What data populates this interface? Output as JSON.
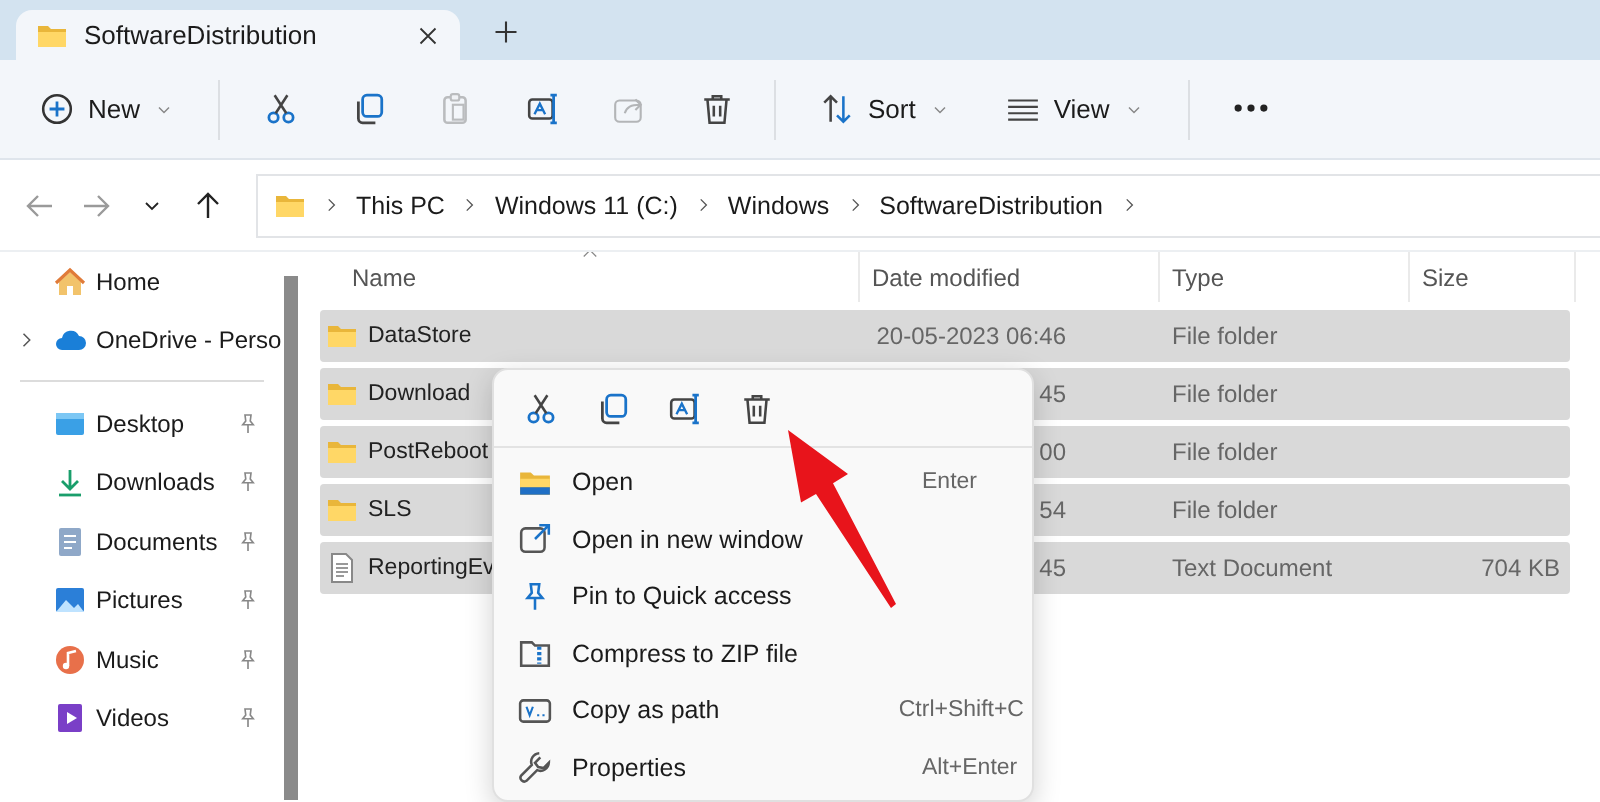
{
  "window": {
    "tabs": [
      {
        "title": "SoftwareDistribution",
        "selected": true
      }
    ]
  },
  "toolbar": {
    "items": [
      {
        "kind": "new",
        "label": "New",
        "disabled": false
      },
      {
        "kind": "separator"
      },
      {
        "kind": "cut",
        "disabled": false
      },
      {
        "kind": "copy",
        "disabled": false
      },
      {
        "kind": "paste",
        "disabled": true
      },
      {
        "kind": "rename",
        "disabled": false
      },
      {
        "kind": "share",
        "disabled": true
      },
      {
        "kind": "delete",
        "disabled": false
      },
      {
        "kind": "separator"
      },
      {
        "kind": "sort",
        "label": "Sort",
        "disabled": false
      },
      {
        "kind": "view",
        "label": "View",
        "disabled": false
      },
      {
        "kind": "separator"
      },
      {
        "kind": "more",
        "disabled": false
      }
    ]
  },
  "navigation": {
    "buttons": [
      {
        "kind": "back",
        "disabled": true
      },
      {
        "kind": "forward",
        "disabled": true
      },
      {
        "kind": "recent",
        "disabled": false
      },
      {
        "kind": "up",
        "disabled": false
      }
    ],
    "breadcrumbs": [
      "This PC",
      "Windows 11 (C:)",
      "Windows",
      "SoftwareDistribution"
    ]
  },
  "sidebar": {
    "top": [
      {
        "kind": "home",
        "label": "Home",
        "expandable": false
      },
      {
        "kind": "cloud",
        "label": "OneDrive - Perso",
        "expandable": true
      }
    ],
    "quick_access": [
      {
        "kind": "desktop",
        "label": "Desktop",
        "pinned": true
      },
      {
        "kind": "downloads",
        "label": "Downloads",
        "pinned": true
      },
      {
        "kind": "documents",
        "label": "Documents",
        "pinned": true
      },
      {
        "kind": "pictures",
        "label": "Pictures",
        "pinned": true
      },
      {
        "kind": "music",
        "label": "Music",
        "pinned": true
      },
      {
        "kind": "videos",
        "label": "Videos",
        "pinned": true
      }
    ]
  },
  "table": {
    "columns": [
      {
        "label": "Name",
        "sorted": true
      },
      {
        "label": "Date modified",
        "sorted": false
      },
      {
        "label": "Type",
        "sorted": false
      },
      {
        "label": "Size",
        "sorted": false
      }
    ],
    "rows": [
      {
        "kind": "folder",
        "name": "DataStore",
        "date": "20-05-2023 06:46",
        "type": "File folder",
        "selected": true
      },
      {
        "kind": "folder",
        "name": "Download",
        "date": "45",
        "type": "File folder",
        "selected": true
      },
      {
        "kind": "folder",
        "name": "PostReboot",
        "date": "00",
        "type": "File folder",
        "selected": true
      },
      {
        "kind": "folder",
        "name": "SLS",
        "date": "54",
        "type": "File folder",
        "selected": true
      },
      {
        "kind": "document",
        "name": "ReportingEv",
        "date": "45",
        "type": "Text Document",
        "size": "704 KB",
        "selected": true
      }
    ]
  },
  "context_menu": {
    "quick_actions": [
      {
        "kind": "cut"
      },
      {
        "kind": "copy"
      },
      {
        "kind": "rename"
      },
      {
        "kind": "delete"
      }
    ],
    "items": [
      {
        "kind": "open",
        "label": "Open",
        "shortcut": "Enter"
      },
      {
        "kind": "new_window",
        "label": "Open in new window"
      },
      {
        "kind": "pin",
        "label": "Pin to Quick access"
      },
      {
        "kind": "zip",
        "label": "Compress to ZIP file"
      },
      {
        "kind": "path",
        "label": "Copy as path",
        "shortcut": "Ctrl+Shift+C"
      },
      {
        "kind": "properties",
        "label": "Properties",
        "shortcut": "Alt+Enter"
      }
    ]
  },
  "annotation": {
    "kind": "arrow"
  }
}
